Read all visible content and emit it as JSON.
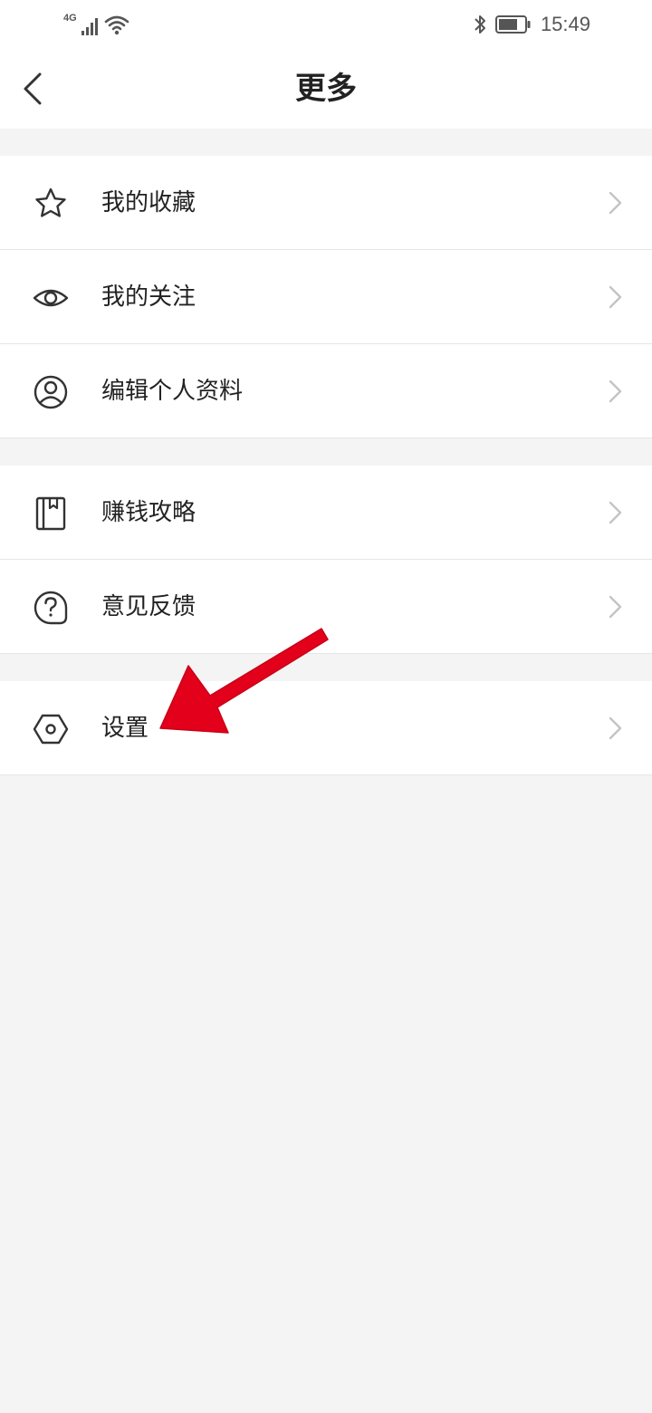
{
  "status_bar": {
    "network": "4G",
    "time": "15:49",
    "icons": [
      "signal-icon",
      "wifi-icon",
      "bluetooth-icon",
      "battery-icon"
    ]
  },
  "header": {
    "title": "更多",
    "back_icon": "back-chevron-icon"
  },
  "groups": [
    {
      "items": [
        {
          "label": "我的收藏",
          "icon": "star-icon"
        },
        {
          "label": "我的关注",
          "icon": "eye-icon"
        },
        {
          "label": "编辑个人资料",
          "icon": "user-icon"
        }
      ]
    },
    {
      "items": [
        {
          "label": "赚钱攻略",
          "icon": "book-icon"
        },
        {
          "label": "意见反馈",
          "icon": "help-icon"
        }
      ]
    },
    {
      "items": [
        {
          "label": "设置",
          "icon": "settings-icon"
        }
      ]
    }
  ],
  "annotation": {
    "arrow_color": "#e3001b"
  },
  "colors": {
    "background": "#f4f4f4",
    "surface": "#ffffff",
    "divider": "#e6e6e6",
    "text": "#222222",
    "chevron": "#c4c4c4"
  }
}
